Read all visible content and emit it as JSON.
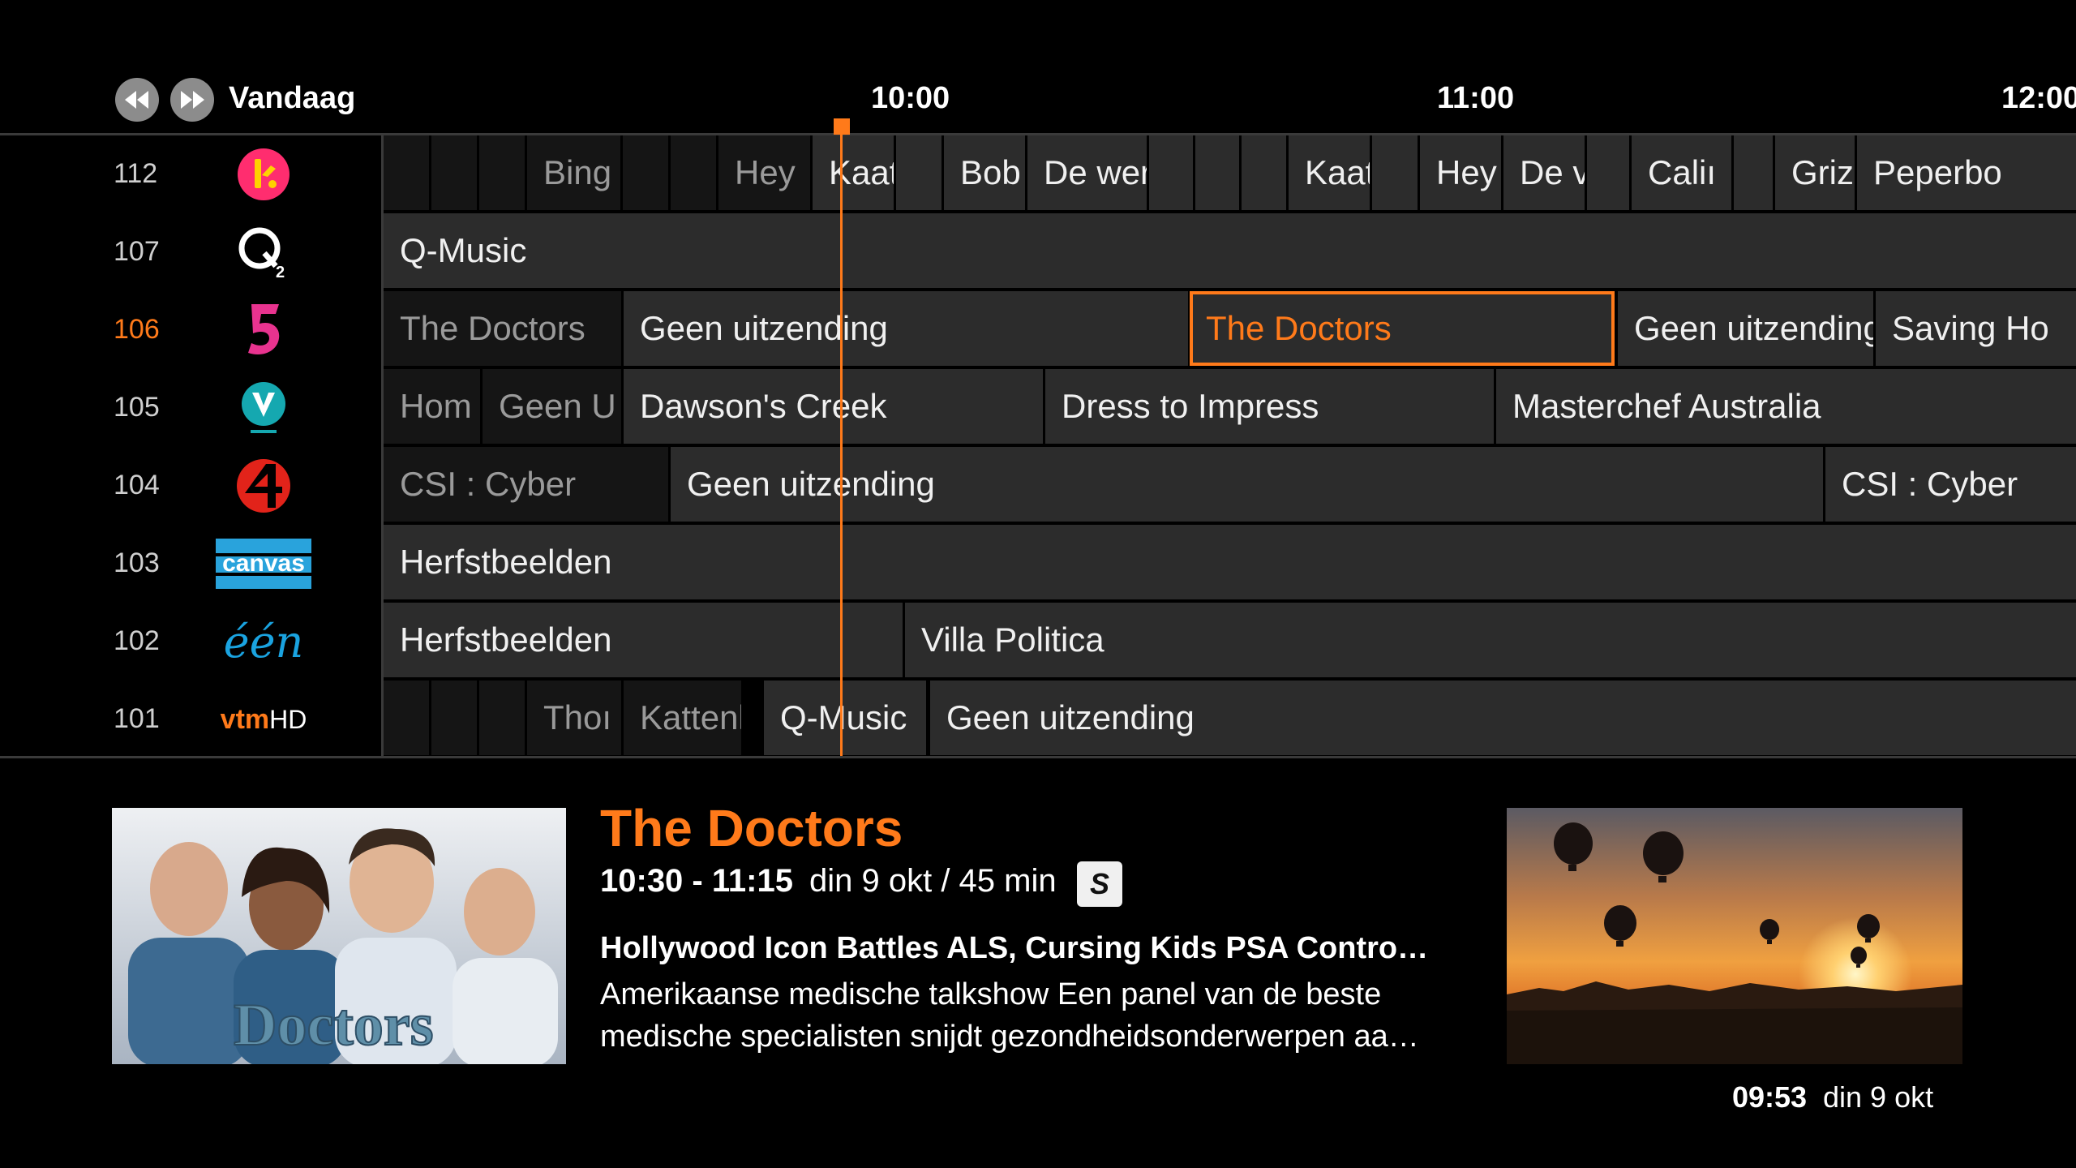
{
  "header": {
    "rewind_icon": "rewind-icon",
    "forward_icon": "fast-forward-icon",
    "day_label": "Vandaag",
    "times": [
      "10:00",
      "11:00",
      "12:00"
    ]
  },
  "channels": [
    {
      "number": "112",
      "logo": "ketnet-logo",
      "active": false
    },
    {
      "number": "107",
      "logo": "q2-logo",
      "active": false
    },
    {
      "number": "106",
      "logo": "vijf-logo",
      "active": true
    },
    {
      "number": "105",
      "logo": "vitaya-logo",
      "active": false
    },
    {
      "number": "104",
      "logo": "vier-logo",
      "active": false
    },
    {
      "number": "103",
      "logo": "canvas-logo",
      "logo_text": "canvas",
      "active": false
    },
    {
      "number": "102",
      "logo": "een-logo",
      "logo_text": "één",
      "active": false
    },
    {
      "number": "101",
      "logo": "vtm-hd-logo",
      "logo_text_a": "vtm",
      "logo_text_b": "HD",
      "active": false
    }
  ],
  "programs": {
    "row112": [
      "",
      "",
      "",
      "Bing",
      "",
      "",
      "Hey",
      "Kaat",
      "",
      "Bob",
      "De wer",
      "",
      "",
      "",
      "Kaat",
      "",
      "Hey",
      "De v",
      "",
      "Caliı",
      "",
      "Griz",
      "Peperbo"
    ],
    "row107": [
      "Q-Music"
    ],
    "row106": [
      "The Doctors",
      "Geen uitzending",
      "The Doctors",
      "Geen uitzending",
      "Saving Ho"
    ],
    "row105": [
      "Hom",
      "Geen U",
      "Dawson's Creek",
      "Dress to Impress",
      "Masterchef Australia"
    ],
    "row104": [
      "CSI : Cyber",
      "Geen uitzending",
      "CSI : Cyber"
    ],
    "row103": [
      "Herfstbeelden"
    ],
    "row102": [
      "Herfstbeelden",
      "Villa Politica"
    ],
    "row101": [
      "",
      "",
      "",
      "Thoı",
      "Kattenl",
      "Q-Music",
      "Geen uitzending"
    ]
  },
  "details": {
    "title": "The Doctors",
    "time": "10:30 - 11:15",
    "date_duration": "din 9 okt / 45 min",
    "subtitle_badge": "S",
    "episode_title": "Hollywood Icon Battles ALS, Cursing Kids PSA Contro…",
    "description": "Amerikaanse medische talkshow Een panel van de beste medische specialisten snijdt gezondheidsonderwerpen aa…",
    "poster_text": "Doctors"
  },
  "clock": {
    "time": "09:53",
    "date": "din 9 okt"
  },
  "colors": {
    "accent": "#ff7a1a",
    "cell": "#2c2c2c",
    "cell_past": "#151515",
    "background": "#000000"
  }
}
